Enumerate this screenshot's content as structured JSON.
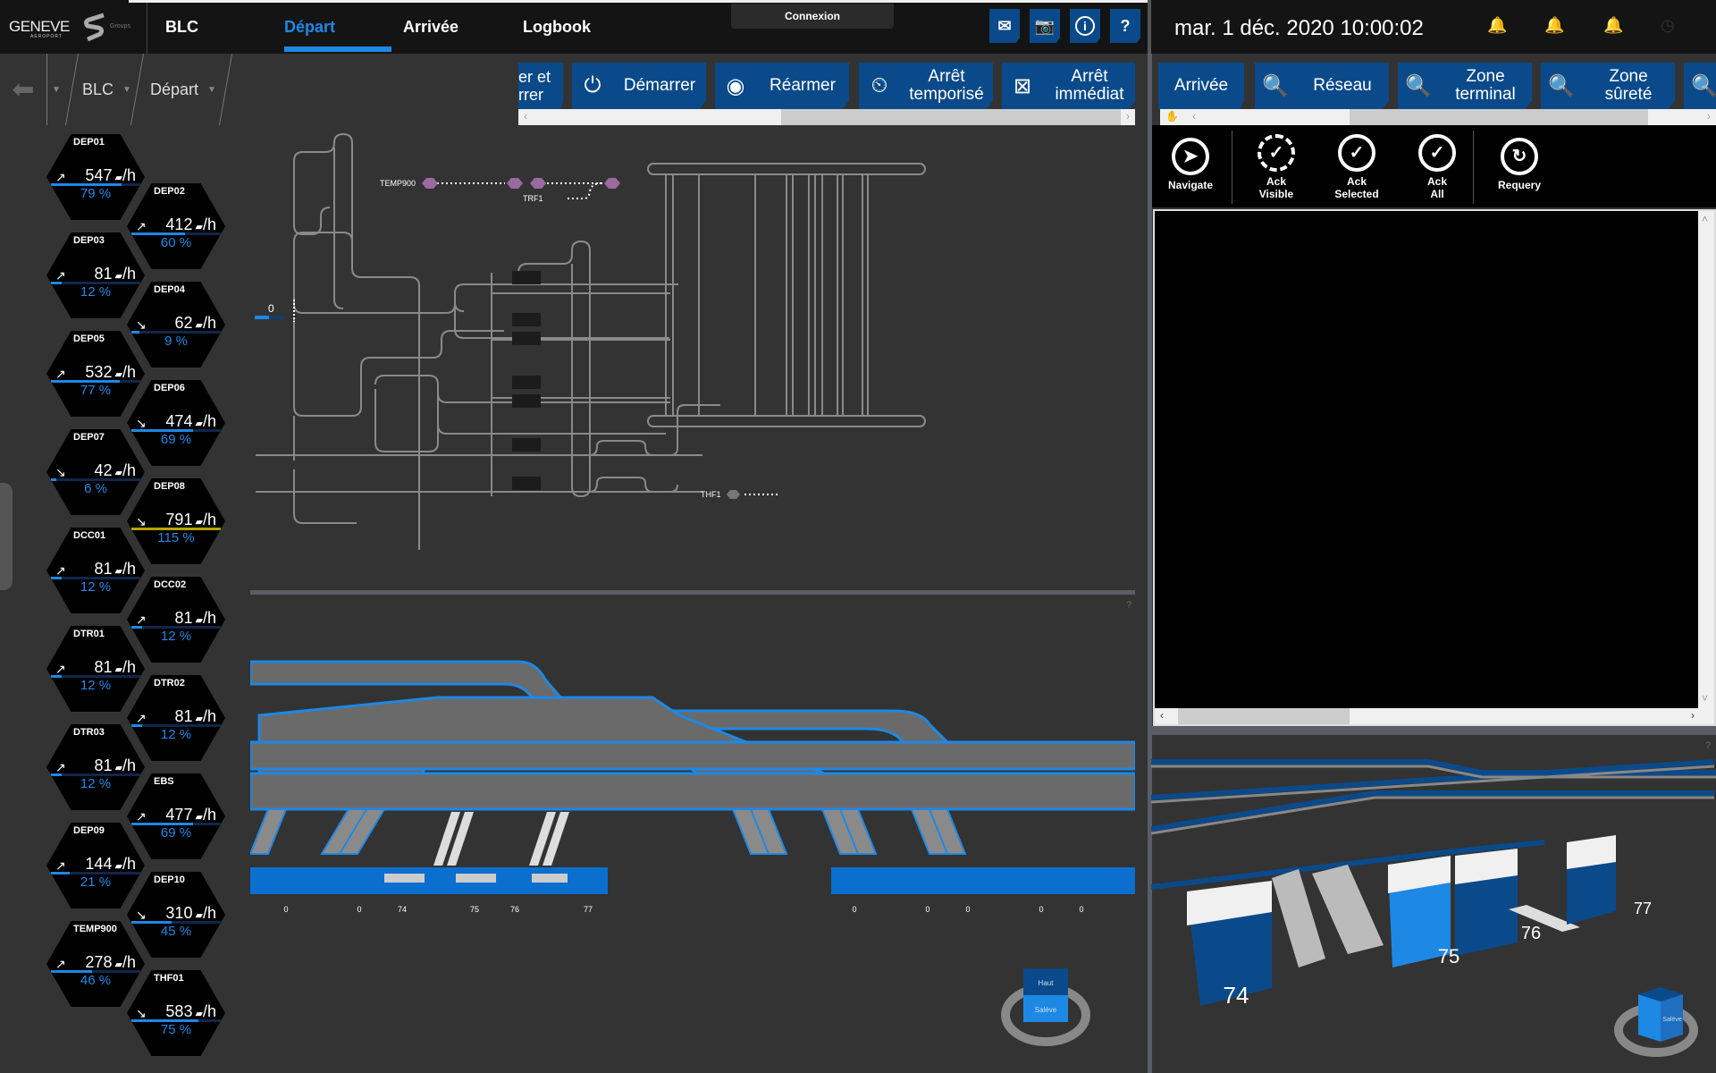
{
  "header": {
    "logo_text": "GENEVE",
    "logo_sub": "AEROPORT",
    "partner_text": "Groups",
    "tabs": [
      {
        "label": "BLC",
        "active": false
      },
      {
        "label": "Départ",
        "active": true
      },
      {
        "label": "Arrivée",
        "active": false
      },
      {
        "label": "Logbook",
        "active": false
      }
    ],
    "connexion_label": "Connexion",
    "icons": [
      "mail-icon",
      "camera-icon",
      "info-icon",
      "help-icon"
    ],
    "help_label": "?",
    "datetime": "mar. 1 déc. 2020 10:00:02"
  },
  "breadcrumb": {
    "items": [
      "BLC",
      "Départ"
    ]
  },
  "actions": {
    "buttons": [
      {
        "label": "…er et\n…rrer",
        "icon": "partial"
      },
      {
        "label": "Démarrer",
        "icon": "power-icon"
      },
      {
        "label": "Réarmer",
        "icon": "record-icon"
      },
      {
        "label": "Arrêt temporisé",
        "line1": "Arrêt",
        "line2": "temporisé",
        "icon": "timed-stop-icon"
      },
      {
        "label": "Arrêt immédiat",
        "line1": "Arrêt",
        "line2": "immédiat",
        "icon": "emergency-stop-icon"
      }
    ]
  },
  "right_panel": {
    "filters": [
      {
        "label": "Arrivée"
      },
      {
        "label": "Réseau"
      },
      {
        "line1": "Zone",
        "line2": "terminal"
      },
      {
        "line1": "Zone",
        "line2": "sûreté"
      }
    ],
    "tools": [
      {
        "line1": "Navigate",
        "line2": ""
      },
      {
        "line1": "Ack",
        "line2": "Visible"
      },
      {
        "line1": "Ack",
        "line2": "Selected"
      },
      {
        "line1": "Ack",
        "line2": "All"
      },
      {
        "line1": "Requery",
        "line2": ""
      }
    ]
  },
  "sidebar": {
    "unit": "/h",
    "stations": [
      {
        "name": "DEP01",
        "rate": "547",
        "pct": "79 %",
        "fill": 0.79,
        "trend": "up"
      },
      {
        "name": "DEP02",
        "rate": "412",
        "pct": "60 %",
        "fill": 0.6,
        "trend": "up"
      },
      {
        "name": "DEP03",
        "rate": "81",
        "pct": "12 %",
        "fill": 0.12,
        "trend": "up"
      },
      {
        "name": "DEP04",
        "rate": "62",
        "pct": "9 %",
        "fill": 0.09,
        "trend": "down"
      },
      {
        "name": "DEP05",
        "rate": "532",
        "pct": "77 %",
        "fill": 0.77,
        "trend": "up"
      },
      {
        "name": "DEP06",
        "rate": "474",
        "pct": "69 %",
        "fill": 0.69,
        "trend": "down"
      },
      {
        "name": "DEP07",
        "rate": "42",
        "pct": "6 %",
        "fill": 0.06,
        "trend": "down"
      },
      {
        "name": "DEP08",
        "rate": "791",
        "pct": "115 %",
        "fill": 1.0,
        "trend": "down",
        "over": true
      },
      {
        "name": "DCC01",
        "rate": "81",
        "pct": "12 %",
        "fill": 0.12,
        "trend": "up"
      },
      {
        "name": "DCC02",
        "rate": "81",
        "pct": "12 %",
        "fill": 0.12,
        "trend": "up"
      },
      {
        "name": "DTR01",
        "rate": "81",
        "pct": "12 %",
        "fill": 0.12,
        "trend": "up"
      },
      {
        "name": "DTR02",
        "rate": "81",
        "pct": "12 %",
        "fill": 0.12,
        "trend": "up"
      },
      {
        "name": "DTR03",
        "rate": "81",
        "pct": "12 %",
        "fill": 0.12,
        "trend": "up"
      },
      {
        "name": "EBS",
        "rate": "477",
        "pct": "69 %",
        "fill": 0.69,
        "trend": "up"
      },
      {
        "name": "DEP09",
        "rate": "144",
        "pct": "21 %",
        "fill": 0.21,
        "trend": "up"
      },
      {
        "name": "DEP10",
        "rate": "310",
        "pct": "45 %",
        "fill": 0.45,
        "trend": "down"
      },
      {
        "name": "TEMP900",
        "rate": "278",
        "pct": "46 %",
        "fill": 0.46,
        "trend": "up"
      },
      {
        "name": "THF01",
        "rate": "583",
        "pct": "75 %",
        "fill": 0.75,
        "trend": "down"
      }
    ]
  },
  "schematic": {
    "labels": {
      "temp900": "TEMP900",
      "trf1": "TRF1",
      "thf1": "THF1",
      "counter": "0"
    },
    "help": "?"
  },
  "view3d": {
    "labels": [
      "0",
      "0",
      "74",
      "75",
      "76",
      "77",
      "0",
      "0",
      "0",
      "0",
      "0"
    ],
    "cube_top": "Haut",
    "cube_front": "Salève",
    "right_labels": [
      "74",
      "75",
      "76",
      "77"
    ],
    "right_cube": "Salève",
    "help": "?"
  },
  "colors": {
    "accent": "#1e88e5",
    "button": "#0b4a8a",
    "over": "#b8a400"
  }
}
